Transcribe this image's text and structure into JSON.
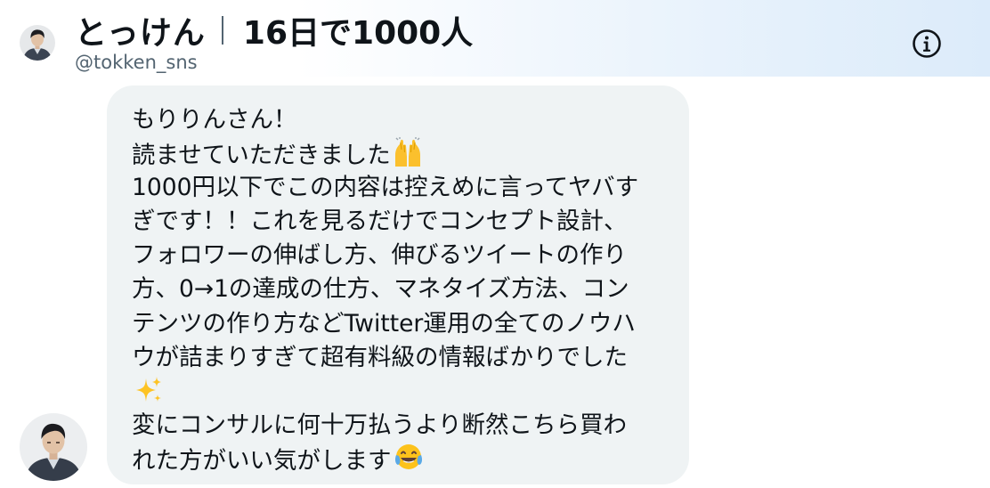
{
  "header": {
    "name": "とっけん",
    "tagline": "16日で1000人",
    "handle": "@tokken_sns",
    "avatar_icon": "profile-photo-icon",
    "info_icon": "info-circle-icon"
  },
  "message": {
    "lines": [
      "もりりんさん！",
      "読ませていただきました",
      "1000円以下でこの内容は控えめに言ってヤバす",
      "ぎです！！これを見るだけでコンセプト設計、",
      "フォロワーの伸ばし方、伸びるツイートの作り",
      "方、0→1の達成の仕方、マネタイズ方法、コン",
      "テンツの作り方などTwitter運用の全てのノウハ",
      "ウが詰まりすぎて超有料級の情報ばかりでした",
      "",
      "変にコンサルに何十万払うより断然こちら買わ",
      "れた方がいい気がします"
    ],
    "emojis": {
      "line2": "raising-hands-emoji",
      "line9": "sparkles-emoji",
      "line11": "tears-of-joy-emoji"
    },
    "sender_avatar_icon": "profile-photo-icon"
  },
  "colors": {
    "bubble": "#eff3f4",
    "text": "#0f1419",
    "secondary": "#536471",
    "header_tint": "#dcebfa"
  }
}
